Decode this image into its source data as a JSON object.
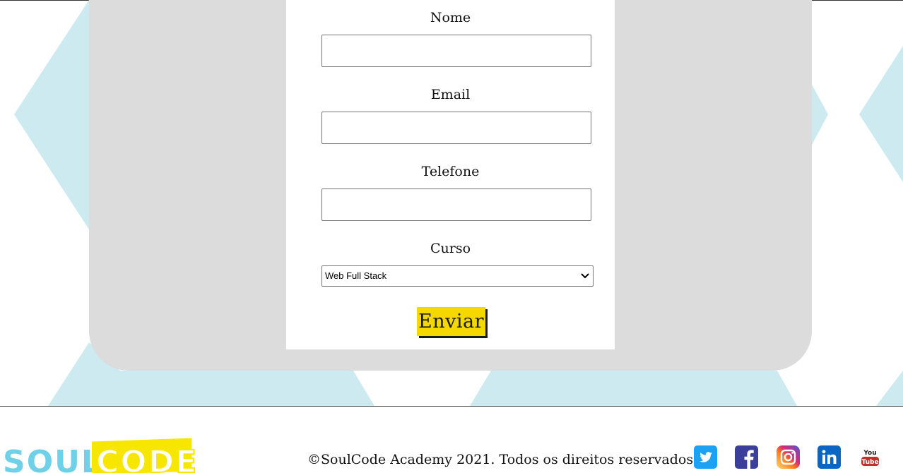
{
  "form": {
    "fields": [
      {
        "label": "Nome",
        "value": "",
        "placeholder": ""
      },
      {
        "label": "Email",
        "value": "",
        "placeholder": ""
      },
      {
        "label": "Telefone",
        "value": "",
        "placeholder": ""
      }
    ],
    "course": {
      "label": "Curso",
      "selected": "Web Full Stack"
    },
    "submit_label": "Enviar"
  },
  "footer": {
    "logo": {
      "part1": "SOUL",
      "part2": "CODE"
    },
    "copyright": "©SoulCode Academy 2021. Todos os direitos reservados",
    "social": [
      {
        "icon": "twitter-icon",
        "color": "#1da1f2"
      },
      {
        "icon": "facebook-icon",
        "color": "#3b3f9a"
      },
      {
        "icon": "instagram-icon",
        "color": "#e1306c"
      },
      {
        "icon": "linkedin-icon",
        "color": "#0a66c2"
      },
      {
        "icon": "youtube-icon",
        "color": "#c4302b"
      }
    ]
  },
  "colors": {
    "panel": "#dcdcdc",
    "pattern": "#cceaf0",
    "button": "#f5d800"
  }
}
